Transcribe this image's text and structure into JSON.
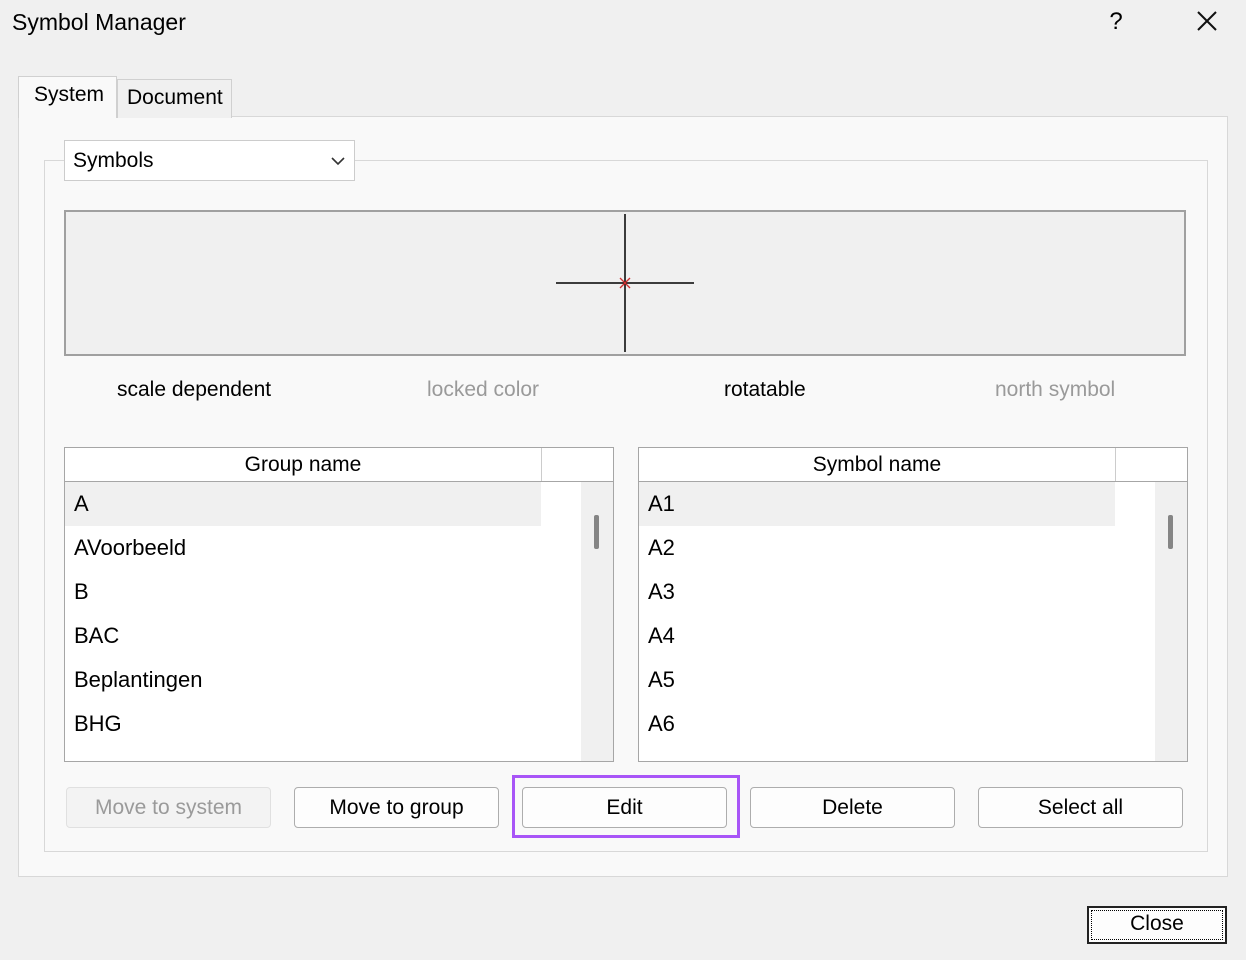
{
  "window": {
    "title": "Symbol Manager",
    "help_label": "?"
  },
  "tabs": [
    {
      "label": "System",
      "active": true
    },
    {
      "label": "Document",
      "active": false
    }
  ],
  "symbols_combo": {
    "value": "Symbols"
  },
  "properties": [
    {
      "label": "scale dependent",
      "enabled": true
    },
    {
      "label": "locked color",
      "enabled": false
    },
    {
      "label": "rotatable",
      "enabled": true
    },
    {
      "label": "north symbol",
      "enabled": false
    }
  ],
  "group_list": {
    "header": "Group name",
    "rows": [
      "A",
      "AVoorbeeld",
      "B",
      "BAC",
      "Beplantingen",
      "BHG"
    ],
    "selected_index": 0
  },
  "symbol_list": {
    "header": "Symbol name",
    "rows": [
      "A1",
      "A2",
      "A3",
      "A4",
      "A5",
      "A6"
    ],
    "selected_index": 0
  },
  "buttons": {
    "move_to_system": "Move to system",
    "move_to_group": "Move to group",
    "edit": "Edit",
    "delete": "Delete",
    "select_all": "Select all",
    "close": "Close"
  },
  "colors": {
    "highlight": "#a855f7",
    "symbol_center": "#d03030"
  },
  "icons": {
    "help": "help-icon",
    "close": "close-icon",
    "dropdown": "chevron-down-icon"
  }
}
